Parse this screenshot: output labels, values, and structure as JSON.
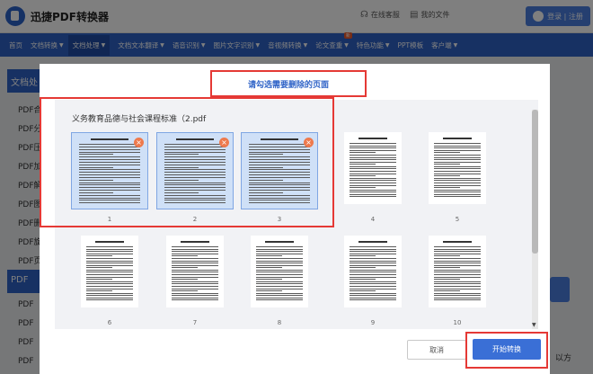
{
  "header": {
    "app_title": "迅捷PDF转换器",
    "service_label": "在线客服",
    "myfiles_label": "我的文件",
    "login_label": "登录 | 注册"
  },
  "nav": {
    "items": [
      {
        "label": "首页",
        "has_menu": false
      },
      {
        "label": "文档转换",
        "has_menu": true
      },
      {
        "label": "文档处理",
        "has_menu": true,
        "active": true
      },
      {
        "label": "文档文本翻译",
        "has_menu": true
      },
      {
        "label": "语音识别",
        "has_menu": true
      },
      {
        "label": "图片文字识别",
        "has_menu": true
      },
      {
        "label": "音视频转换",
        "has_menu": true
      },
      {
        "label": "论文查重",
        "has_menu": true,
        "badge": "新"
      },
      {
        "label": "特色功能",
        "has_menu": true
      },
      {
        "label": "PPT模板",
        "has_menu": false
      },
      {
        "label": "客户端",
        "has_menu": true
      }
    ]
  },
  "background": {
    "section1_label": "文档处",
    "section2_label": "PDF",
    "side_items_1": [
      "PDF合",
      "PDF分",
      "PDF压",
      "PDF加",
      "PDF解",
      "PDF图",
      "PDF删",
      "PDF旋",
      "PDF页"
    ],
    "side_items_2": [
      "PDF",
      "PDF",
      "PDF",
      "PDF"
    ],
    "right_text": "器，以方"
  },
  "modal": {
    "title": "请勾选需要删除的页面",
    "filename": "义务教育品德与社会课程标准（2.pdf",
    "delete_mark": "×",
    "pages": [
      {
        "num": "1",
        "selected": true
      },
      {
        "num": "2",
        "selected": true
      },
      {
        "num": "3",
        "selected": true
      },
      {
        "num": "4",
        "selected": false
      },
      {
        "num": "5",
        "selected": false
      },
      {
        "num": "6",
        "selected": false
      },
      {
        "num": "7",
        "selected": false
      },
      {
        "num": "8",
        "selected": false
      },
      {
        "num": "9",
        "selected": false
      },
      {
        "num": "10",
        "selected": false
      }
    ],
    "cancel_label": "取消",
    "start_label": "开始转换"
  },
  "colors": {
    "brand": "#2f63c7",
    "highlight_border": "#e53935",
    "selected_page": "#cfe0f7",
    "delete_badge": "#ee7a4d"
  }
}
